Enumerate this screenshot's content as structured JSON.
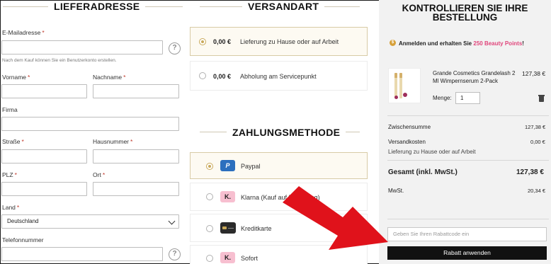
{
  "shipping_address": {
    "title": "LIEFERADRESSE",
    "email_label": "E-Mailadresse",
    "email_hint": "Nach dem Kauf können Sie ein Benutzerkonto erstellen.",
    "firstname_label": "Vorname",
    "lastname_label": "Nachname",
    "company_label": "Firma",
    "street_label": "Straße",
    "housenumber_label": "Hausnummer",
    "zip_label": "PLZ",
    "city_label": "Ort",
    "country_label": "Land",
    "country_value": "Deutschland",
    "phone_label": "Telefonnummer",
    "required_mark": "*",
    "help_glyph": "?"
  },
  "shipping_method": {
    "title": "VERSANDART",
    "options": [
      {
        "price": "0,00 €",
        "label": "Lieferung zu Hause oder auf Arbeit",
        "selected": true
      },
      {
        "price": "0,00 €",
        "label": "Abholung am Servicepunkt",
        "selected": false
      }
    ]
  },
  "payment_method": {
    "title": "ZAHLUNGSMETHODE",
    "options": [
      {
        "icon": "paypal-icon",
        "icon_text": "P",
        "label": "Paypal",
        "selected": true
      },
      {
        "icon": "klarna-icon",
        "icon_text": "K.",
        "label": "Klarna (Kauf auf Rechnung)",
        "selected": false
      },
      {
        "icon": "credit-card-icon",
        "icon_text": "",
        "label": "Kreditkarte",
        "selected": false
      },
      {
        "icon": "sofort-icon",
        "icon_text": "K.",
        "label": "Sofort",
        "selected": false
      }
    ]
  },
  "summary": {
    "title_line1": "KONTROLLIEREN SIE IHRE",
    "title_line2": "BESTELLUNG",
    "points_prefix": "Anmelden und erhalten Sie",
    "points_highlight": "250 Beauty Points",
    "points_suffix": "!",
    "product": {
      "name_line1": "Grande Cosmetics Grandelash 2",
      "name_line2": "Ml Wimpernserum 2-Pack",
      "price": "127,38 €",
      "qty_label": "Menge:",
      "qty_value": "1"
    },
    "subtotal_label": "Zwischensumme",
    "subtotal_value": "127,38 €",
    "shipping_label": "Versandkosten",
    "shipping_value": "0,00 €",
    "shipping_method": "Lieferung zu Hause oder auf Arbeit",
    "total_label": "Gesamt (inkl. MwSt.)",
    "total_value": "127,38 €",
    "tax_label": "MwSt.",
    "tax_value": "20,34 €",
    "coupon_placeholder": "Geben Sie Ihren Rabattcode ein",
    "apply_label": "Rabatt anwenden"
  },
  "colors": {
    "accent_gold": "#c9a95a",
    "points_pink": "#e0457b",
    "arrow_red": "#e0121b",
    "paypal_blue": "#2c6fbe",
    "klarna_pink": "#f7bfd0"
  }
}
